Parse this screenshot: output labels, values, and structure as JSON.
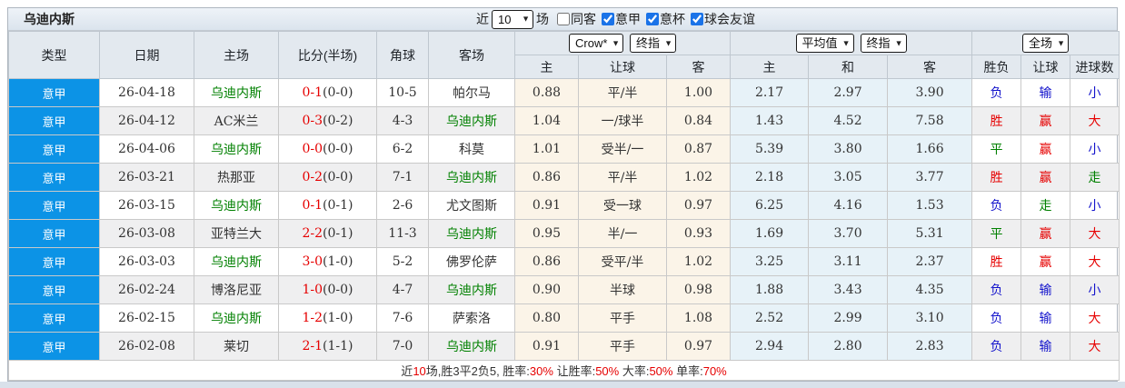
{
  "title": "乌迪内斯",
  "toolbar": {
    "near_label": "近",
    "match_count": "10",
    "matches_label": "场",
    "checkboxes": [
      {
        "label": "同客",
        "checked": false
      },
      {
        "label": "意甲",
        "checked": true
      },
      {
        "label": "意杯",
        "checked": true
      },
      {
        "label": "球会友谊",
        "checked": true
      }
    ]
  },
  "header": {
    "static_cols": [
      "类型",
      "日期",
      "主场",
      "比分(半场)",
      "角球",
      "客场"
    ],
    "asian_group": {
      "selects": [
        "Crow*",
        "终指"
      ],
      "cols": [
        "主",
        "让球",
        "客"
      ]
    },
    "euro_group": {
      "selects": [
        "平均值",
        "终指"
      ],
      "cols": [
        "主",
        "和",
        "客"
      ]
    },
    "result_group": {
      "selects": [
        "全场"
      ],
      "cols": [
        "胜负",
        "让球",
        "进球数"
      ]
    }
  },
  "colors": {
    "league_bg": "#0c93e6",
    "league_text": "#ffffff",
    "team_green": "#008000",
    "score_red": "#e60000",
    "red": "#e60000",
    "blue": "#1414cc",
    "green": "#008000",
    "text_dark": "#333333"
  },
  "rows": [
    {
      "league": "意甲",
      "date": "26-04-18",
      "home": "乌迪内斯",
      "home_is_team": true,
      "score": "0-1",
      "half": "(0-0)",
      "corner": "10-5",
      "away": "帕尔马",
      "away_is_team": false,
      "asian": [
        "0.88",
        "平/半",
        "1.00"
      ],
      "euro": [
        "2.17",
        "2.97",
        "3.90"
      ],
      "results": [
        {
          "text": "负",
          "color": "blue"
        },
        {
          "text": "输",
          "color": "blue"
        },
        {
          "text": "小",
          "color": "blue"
        }
      ]
    },
    {
      "league": "意甲",
      "date": "26-04-12",
      "home": "AC米兰",
      "home_is_team": false,
      "score": "0-3",
      "half": "(0-2)",
      "corner": "4-3",
      "away": "乌迪内斯",
      "away_is_team": true,
      "asian": [
        "1.04",
        "一/球半",
        "0.84"
      ],
      "euro": [
        "1.43",
        "4.52",
        "7.58"
      ],
      "results": [
        {
          "text": "胜",
          "color": "red"
        },
        {
          "text": "赢",
          "color": "red"
        },
        {
          "text": "大",
          "color": "red"
        }
      ]
    },
    {
      "league": "意甲",
      "date": "26-04-06",
      "home": "乌迪内斯",
      "home_is_team": true,
      "score": "0-0",
      "half": "(0-0)",
      "corner": "6-2",
      "away": "科莫",
      "away_is_team": false,
      "asian": [
        "1.01",
        "受半/一",
        "0.87"
      ],
      "euro": [
        "5.39",
        "3.80",
        "1.66"
      ],
      "results": [
        {
          "text": "平",
          "color": "green"
        },
        {
          "text": "赢",
          "color": "red"
        },
        {
          "text": "小",
          "color": "blue"
        }
      ]
    },
    {
      "league": "意甲",
      "date": "26-03-21",
      "home": "热那亚",
      "home_is_team": false,
      "score": "0-2",
      "half": "(0-0)",
      "corner": "7-1",
      "away": "乌迪内斯",
      "away_is_team": true,
      "asian": [
        "0.86",
        "平/半",
        "1.02"
      ],
      "euro": [
        "2.18",
        "3.05",
        "3.77"
      ],
      "results": [
        {
          "text": "胜",
          "color": "red"
        },
        {
          "text": "赢",
          "color": "red"
        },
        {
          "text": "走",
          "color": "green"
        }
      ]
    },
    {
      "league": "意甲",
      "date": "26-03-15",
      "home": "乌迪内斯",
      "home_is_team": true,
      "score": "0-1",
      "half": "(0-1)",
      "corner": "2-6",
      "away": "尤文图斯",
      "away_is_team": false,
      "asian": [
        "0.91",
        "受一球",
        "0.97"
      ],
      "euro": [
        "6.25",
        "4.16",
        "1.53"
      ],
      "results": [
        {
          "text": "负",
          "color": "blue"
        },
        {
          "text": "走",
          "color": "green"
        },
        {
          "text": "小",
          "color": "blue"
        }
      ]
    },
    {
      "league": "意甲",
      "date": "26-03-08",
      "home": "亚特兰大",
      "home_is_team": false,
      "score": "2-2",
      "half": "(0-1)",
      "corner": "11-3",
      "away": "乌迪内斯",
      "away_is_team": true,
      "asian": [
        "0.95",
        "半/一",
        "0.93"
      ],
      "euro": [
        "1.69",
        "3.70",
        "5.31"
      ],
      "results": [
        {
          "text": "平",
          "color": "green"
        },
        {
          "text": "赢",
          "color": "red"
        },
        {
          "text": "大",
          "color": "red"
        }
      ]
    },
    {
      "league": "意甲",
      "date": "26-03-03",
      "home": "乌迪内斯",
      "home_is_team": true,
      "score": "3-0",
      "half": "(1-0)",
      "corner": "5-2",
      "away": "佛罗伦萨",
      "away_is_team": false,
      "asian": [
        "0.86",
        "受平/半",
        "1.02"
      ],
      "euro": [
        "3.25",
        "3.11",
        "2.37"
      ],
      "results": [
        {
          "text": "胜",
          "color": "red"
        },
        {
          "text": "赢",
          "color": "red"
        },
        {
          "text": "大",
          "color": "red"
        }
      ]
    },
    {
      "league": "意甲",
      "date": "26-02-24",
      "home": "博洛尼亚",
      "home_is_team": false,
      "score": "1-0",
      "half": "(0-0)",
      "corner": "4-7",
      "away": "乌迪内斯",
      "away_is_team": true,
      "asian": [
        "0.90",
        "半球",
        "0.98"
      ],
      "euro": [
        "1.88",
        "3.43",
        "4.35"
      ],
      "results": [
        {
          "text": "负",
          "color": "blue"
        },
        {
          "text": "输",
          "color": "blue"
        },
        {
          "text": "小",
          "color": "blue"
        }
      ]
    },
    {
      "league": "意甲",
      "date": "26-02-15",
      "home": "乌迪内斯",
      "home_is_team": true,
      "score": "1-2",
      "half": "(1-0)",
      "corner": "7-6",
      "away": "萨索洛",
      "away_is_team": false,
      "asian": [
        "0.80",
        "平手",
        "1.08"
      ],
      "euro": [
        "2.52",
        "2.99",
        "3.10"
      ],
      "results": [
        {
          "text": "负",
          "color": "blue"
        },
        {
          "text": "输",
          "color": "blue"
        },
        {
          "text": "大",
          "color": "red"
        }
      ]
    },
    {
      "league": "意甲",
      "date": "26-02-08",
      "home": "莱切",
      "home_is_team": false,
      "score": "2-1",
      "half": "(1-1)",
      "corner": "7-0",
      "away": "乌迪内斯",
      "away_is_team": true,
      "asian": [
        "0.91",
        "平手",
        "0.97"
      ],
      "euro": [
        "2.94",
        "2.80",
        "2.83"
      ],
      "results": [
        {
          "text": "负",
          "color": "blue"
        },
        {
          "text": "输",
          "color": "blue"
        },
        {
          "text": "大",
          "color": "red"
        }
      ]
    }
  ],
  "footer": {
    "segments": [
      {
        "text": "近",
        "color": "#333333"
      },
      {
        "text": "10",
        "color": "#e60000"
      },
      {
        "text": "场,胜3平2负5, 胜率:",
        "color": "#333333"
      },
      {
        "text": "30%",
        "color": "#e60000"
      },
      {
        "text": " 让胜率:",
        "color": "#333333"
      },
      {
        "text": "50%",
        "color": "#e60000"
      },
      {
        "text": " 大率:",
        "color": "#333333"
      },
      {
        "text": "50%",
        "color": "#e60000"
      },
      {
        "text": " 单率:",
        "color": "#333333"
      },
      {
        "text": "70%",
        "color": "#e60000"
      }
    ]
  }
}
